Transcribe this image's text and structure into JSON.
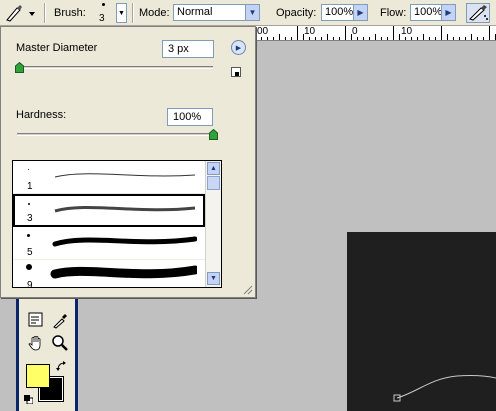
{
  "options_bar": {
    "brush_label": "Brush:",
    "brush_size": "3",
    "mode_label": "Mode:",
    "mode_value": "Normal",
    "opacity_label": "Opacity:",
    "opacity_value": "100%",
    "flow_label": "Flow:",
    "flow_value": "100%"
  },
  "ruler": {
    "labels": [
      "00",
      "10",
      "0",
      "10"
    ]
  },
  "brush_popup": {
    "master_diameter_label": "Master Diameter",
    "master_diameter_value": "3 px",
    "master_diameter_level": 0.01,
    "hardness_label": "Hardness:",
    "hardness_value": "100%",
    "hardness_level": 1.0,
    "presets": [
      {
        "size": "1",
        "selected": false
      },
      {
        "size": "3",
        "selected": true
      },
      {
        "size": "5",
        "selected": false
      },
      {
        "size": "9",
        "selected": false
      }
    ]
  },
  "colors": {
    "foreground": "#ffff66",
    "background": "#000000",
    "canvas": "#1f1f1f",
    "workspace": "#c0c0c0",
    "panel": "#ece9d8"
  },
  "icons": [
    "brush-tool-icon",
    "chevron-down-icon",
    "right-arrow-icon",
    "airbrush-icon",
    "popup-menu-icon",
    "new-preset-icon",
    "notes-icon",
    "eyedropper-icon",
    "hand-icon",
    "zoom-icon",
    "swap-colors-icon",
    "default-colors-icon"
  ]
}
